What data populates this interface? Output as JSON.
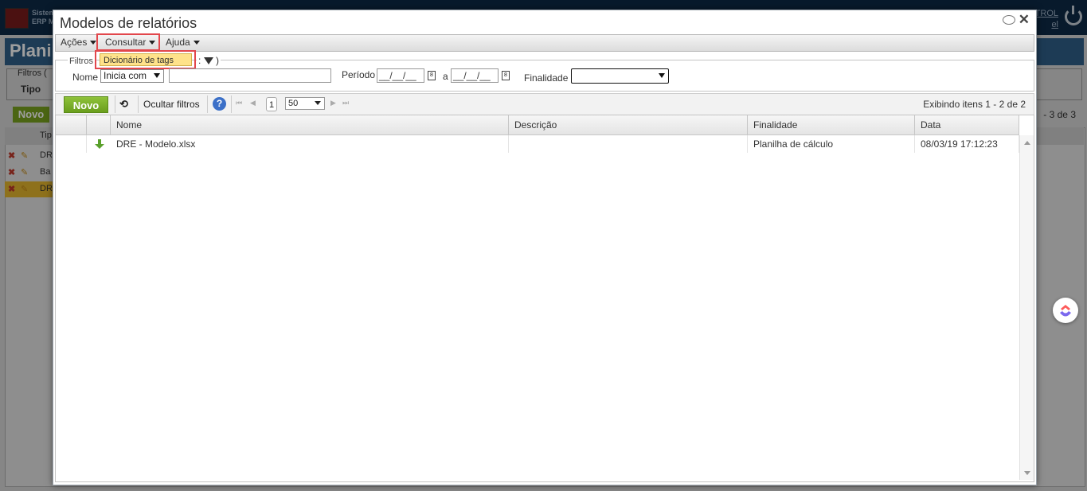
{
  "background": {
    "system_line1": "Sistem",
    "system_line2": "ERP M",
    "user_line1": "TROL",
    "user_line2": "el",
    "page_title": "Plani",
    "filtros_label": "Filtros (",
    "tipo_label": "Tipo",
    "novo_label": "Novo",
    "exibindo": "- 3 de 3",
    "col_tipo": "Tip",
    "rows": [
      "DR",
      "Ba",
      "DR"
    ]
  },
  "modal": {
    "title": "Modelos de relatórios",
    "menu": {
      "acoes": "Ações",
      "consultar": "Consultar",
      "ajuda": "Ajuda",
      "dropdown_item": "Dicionário de tags"
    },
    "filters": {
      "legend": "Filtros",
      "legend_tail": ":",
      "legend_close": ")",
      "nome_label": "Nome",
      "nome_operator": "Inicia com",
      "nome_value": "",
      "periodo_label": "Período",
      "periodo_from": "__/__/__",
      "periodo_sep": "a",
      "periodo_to": "__/__/__",
      "finalidade_label": "Finalidade",
      "finalidade_value": ""
    },
    "toolbar": {
      "novo": "Novo",
      "ocultar_filtros": "Ocultar filtros",
      "help": "?",
      "page": "1",
      "page_size": "50",
      "exibindo": "Exibindo itens 1 - 2 de 2"
    },
    "grid": {
      "columns": [
        "Nome",
        "Descrição",
        "Finalidade",
        "Data"
      ],
      "rows": [
        {
          "nome": "DRE - Modelo.xlsx",
          "descricao": "",
          "finalidade": "Planilha de cálculo",
          "data": "08/03/19 17:12:23"
        }
      ]
    }
  },
  "colors": {
    "accent_green": "#7aa31f",
    "highlight_red": "#e2474c",
    "dropdown_yellow": "#ffe28a",
    "help_blue": "#3c70c8"
  }
}
